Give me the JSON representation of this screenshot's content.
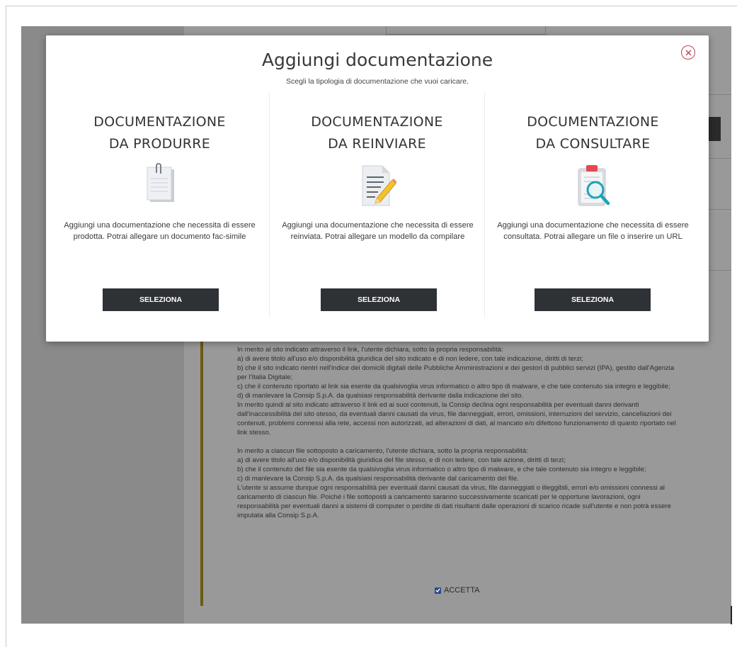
{
  "modal": {
    "title": "Aggiungi documentazione",
    "subtitle": "Scegli la tipologia di documentazione che vuoi caricare.",
    "options": [
      {
        "title_line1": "DOCUMENTAZIONE",
        "title_line2": "DA PRODURRE",
        "icon": "paperclip-document-icon",
        "description": "Aggiungi una documentazione che necessita di essere prodotta. Potrai allegare un documento fac-simile",
        "button": "SELEZIONA"
      },
      {
        "title_line1": "DOCUMENTAZIONE",
        "title_line2": "DA REINVIARE",
        "icon": "document-pencil-icon",
        "description": "Aggiungi una documentazione che necessita di essere reinviata. Potrai allegare un modello da compilare",
        "button": "SELEZIONA"
      },
      {
        "title_line1": "DOCUMENTAZIONE",
        "title_line2": "DA CONSULTARE",
        "icon": "clipboard-magnifier-icon",
        "description": "Aggiungi una documentazione che necessita di essere consultata. Potrai allegare un file o inserire un URL",
        "button": "SELEZIONA"
      }
    ]
  },
  "terms": {
    "text": "In merito al sito indicato attraverso il link, l'utente dichiara, sotto la propria responsabilità:\na) di avere titolo all'uso e/o disponibilità giuridica del sito indicato e di non ledere, con tale indicazione, diritti di terzi;\nb) che il sito indicato rientri nell'indice dei domicili digitali delle Pubbliche Amministrazioni e dei gestori di pubblici servizi (IPA), gestito dall'Agenzia per l'Italia Digitale;\nc) che il contenuto riportato al link sia esente da qualsivoglia virus informatico o altro tipo di malware, e che tale contenuto sia integro e leggibile;\nd) di manlevare la Consip S.p.A. da qualsiasi responsabilità derivante dalla indicazione del sito.\nIn merito quindi al sito indicato attraverso il link ed ai suoi contenuti, la Consip declina ogni responsabilità per eventuali danni derivanti dall'inaccessibilità del sito stesso, da eventuali danni causati da virus, file danneggiati, errori, omissioni, interruzioni del servizio, cancellazioni dei contenuti, problemi connessi alla rete, accessi non autorizzati, ad alterazioni di dati, al mancato e/o difettoso funzionamento di quanto riportato nel link stesso.\n\nIn merito a ciascun file sottoposto a caricamento, l'utente dichiara, sotto la propria responsabilità:\na) di avere titolo all'uso e/o disponibilità giuridica del file stesso, e di non ledere, con tale azione, diritti di terzi;\nb) che il contenuto del file sia esente da qualsivoglia virus informatico o altro tipo di malware, e che tale contenuto sia integro e leggibile;\nc) di manlevare la Consip S.p.A. da qualsiasi responsabilità derivante dal caricamento del file.\nL'utente si assume dunque ogni responsabilità per eventuali danni causati da virus, file danneggiati o illeggibili, errori e/o omissioni connessi al caricamento di ciascun file. Poiché i file sottoposti a caricamento saranno successivamente scaricati per le opportune lavorazioni, ogni responsabilità per eventuali danni a sistemi di computer o perdite di dati risultanti dalle operazioni di scarico ricade sull'utente e non potrà essere imputata alla Consip S.p.A.",
    "accept_label": "ACCETTA",
    "accept_checked": true
  },
  "colors": {
    "button_bg": "#2e3136",
    "close_accent": "#c0405a",
    "accent_bar": "#6b5a12"
  }
}
